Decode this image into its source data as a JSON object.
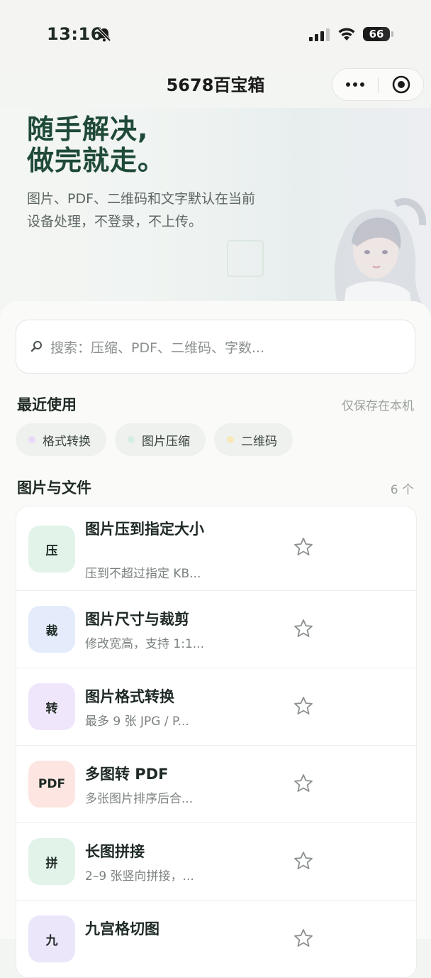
{
  "status_bar": {
    "time": "13:16",
    "battery": "66",
    "battery_level": 0.66
  },
  "nav": {
    "title": "5678百宝箱"
  },
  "hero": {
    "title_line1": "随手解决,",
    "title_line2": "做完就走。",
    "subtitle": "图片、PDF、二维码和文字默认在当前设备处理，不登录，不上传。"
  },
  "search": {
    "placeholder": "搜索：压缩、PDF、二维码、字数..."
  },
  "recent": {
    "title": "最近使用",
    "note": "仅保存在本机",
    "chips": [
      {
        "label": "格式转换",
        "dot_color": "#ead9f6"
      },
      {
        "label": "图片压缩",
        "dot_color": "#d5eee2"
      },
      {
        "label": "二维码",
        "dot_color": "#f8e8b8"
      }
    ]
  },
  "files_section": {
    "title": "图片与文件",
    "count": "6 个",
    "tools": [
      {
        "badge": "压",
        "badge_color": "#e2f3ea",
        "title": "图片压到指定大小",
        "desc": "压到不超过指定 KB..."
      },
      {
        "badge": "裁",
        "badge_color": "#e4ecfb",
        "title": "图片尺寸与裁剪",
        "desc": "修改宽高，支持 1:1..."
      },
      {
        "badge": "转",
        "badge_color": "#f0e6fb",
        "title": "图片格式转换",
        "desc": "最多 9 张 JPG / P..."
      },
      {
        "badge": "PDF",
        "badge_color": "#fde6e2",
        "title": "多图转 PDF",
        "desc": "多张图片排序后合..."
      },
      {
        "badge": "拼",
        "badge_color": "#e2f3ea",
        "title": "长图拼接",
        "desc": "2–9 张竖向拼接，..."
      },
      {
        "badge": "九",
        "badge_color": "#ece6fb",
        "title": "九宫格切图",
        "desc": ""
      }
    ]
  }
}
